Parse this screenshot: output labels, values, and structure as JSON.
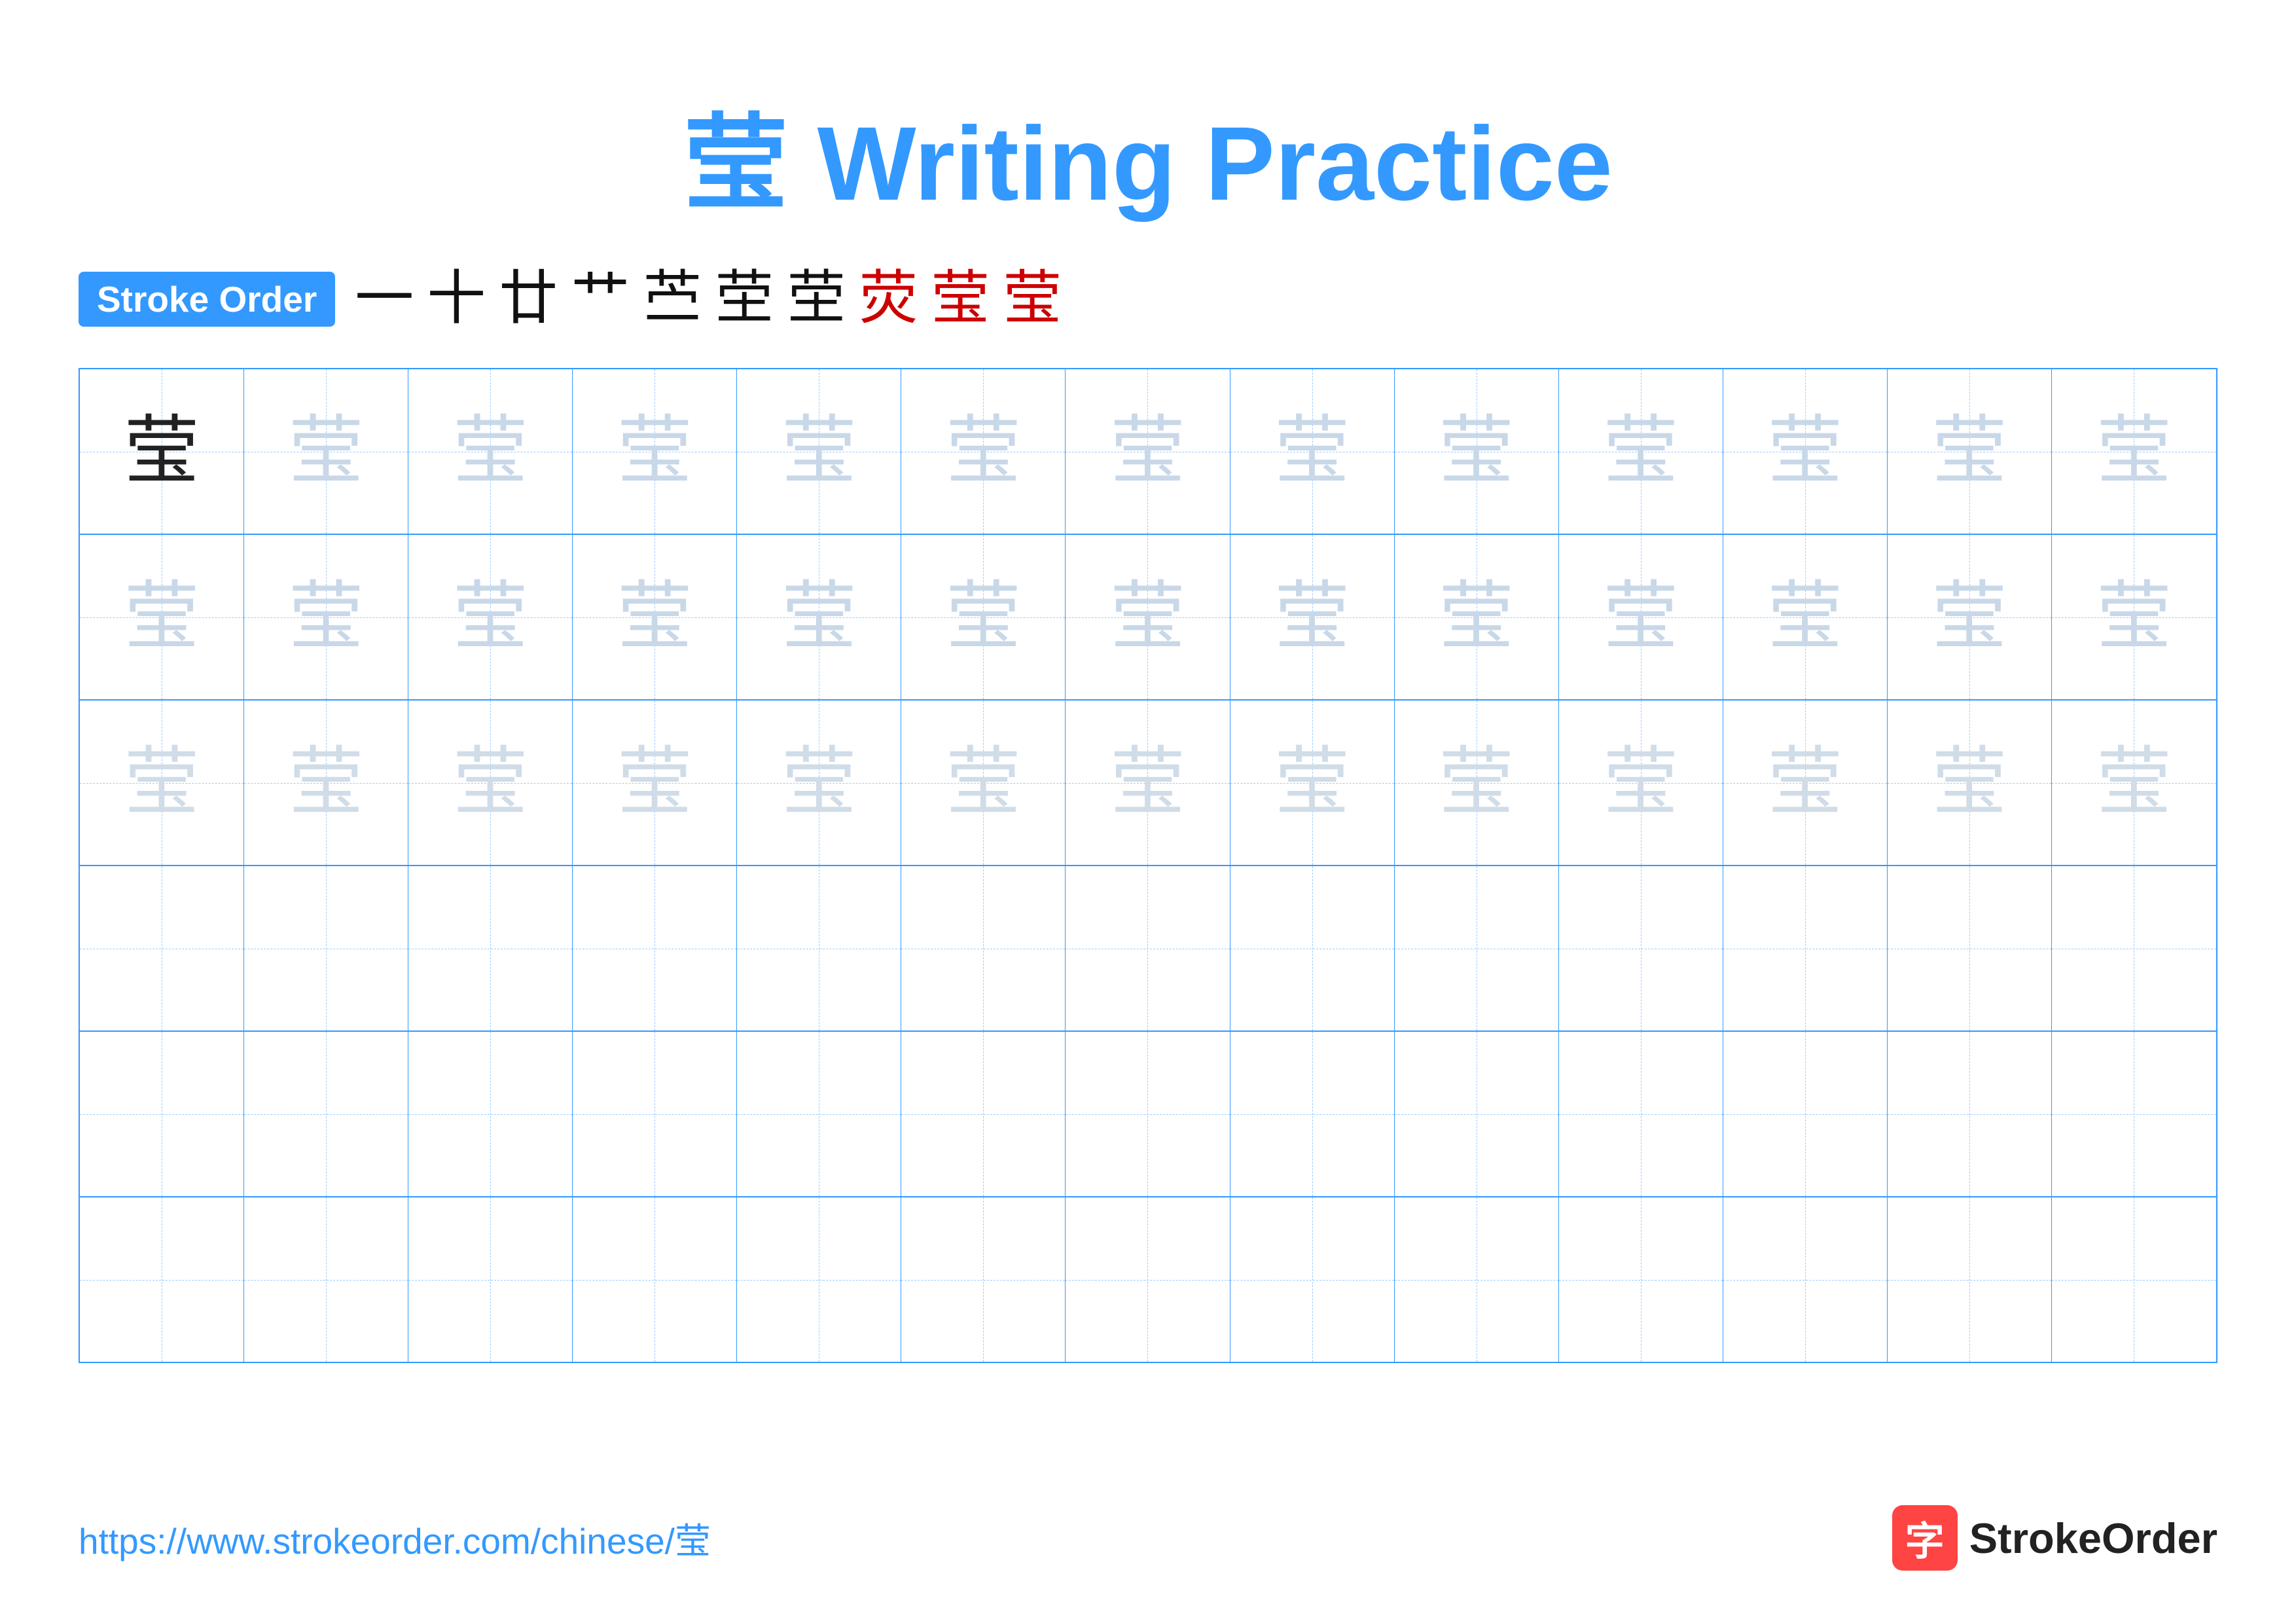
{
  "title": {
    "char": "莹",
    "text": " Writing Practice",
    "full": "莹 Writing Practice"
  },
  "stroke_order": {
    "badge_label": "Stroke Order",
    "strokes": [
      "一",
      "十",
      "廿",
      "艹",
      "艹",
      "茔",
      "茔",
      "茔",
      "茔",
      "莹"
    ]
  },
  "grid": {
    "rows": 6,
    "cols": 13,
    "char": "莹",
    "row_styles": [
      "dark",
      "light1",
      "light2",
      "empty",
      "empty",
      "empty"
    ]
  },
  "footer": {
    "url": "https://www.strokeorder.com/chinese/莹",
    "brand_name": "StrokeOrder",
    "logo_char": "字"
  }
}
